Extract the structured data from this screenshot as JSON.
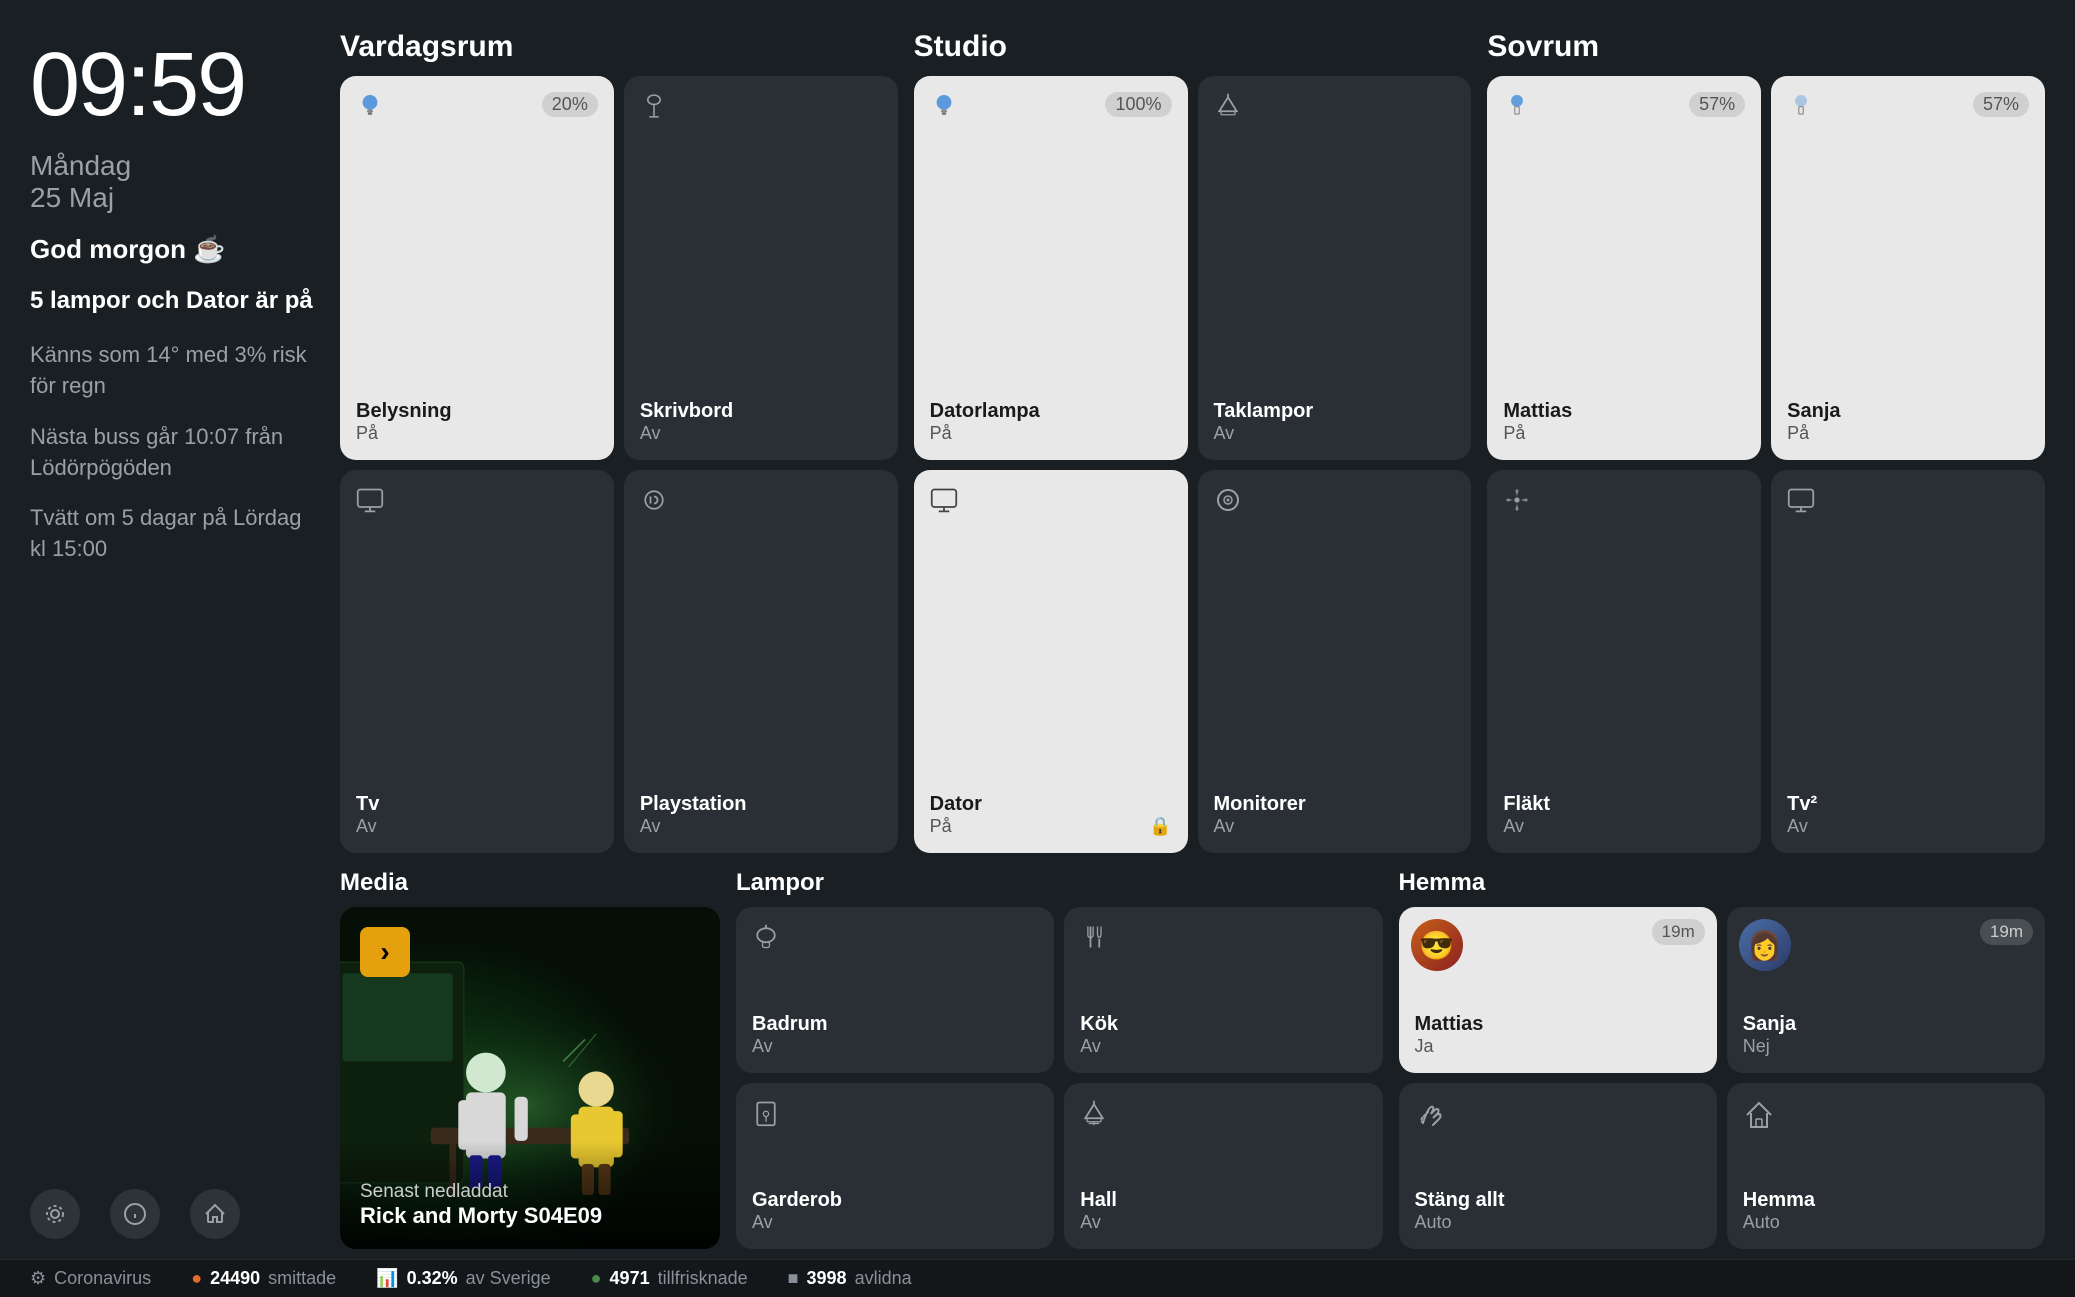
{
  "clock": {
    "time": "09:59",
    "day": "Måndag",
    "date": "25 Maj"
  },
  "sidebar": {
    "greeting": "God morgon ☕",
    "alert": "5 lampor och Dator är på",
    "weather": "Känns som 14° med 3% risk för regn",
    "bus": "Nästa buss går 10:07 från Lödörpögöden",
    "laundry": "Tvätt om 5 dagar på Lördag kl 15:00"
  },
  "rooms": {
    "vardagsrum": {
      "title": "Vardagsrum",
      "tiles": [
        {
          "label": "Belysning",
          "status": "På",
          "active": true,
          "percent": "20%",
          "icon": "bulb"
        },
        {
          "label": "Skrivbord",
          "status": "Av",
          "active": false,
          "icon": "lamp"
        },
        {
          "label": "Tv",
          "status": "Av",
          "active": false,
          "icon": "tv"
        },
        {
          "label": "Playstation",
          "status": "Av",
          "active": false,
          "icon": "ps"
        }
      ]
    },
    "studio": {
      "title": "Studio",
      "tiles": [
        {
          "label": "Datorlampa",
          "status": "På",
          "active": true,
          "percent": "100%",
          "icon": "bulb"
        },
        {
          "label": "Taklampor",
          "status": "Av",
          "active": false,
          "icon": "ceiling"
        },
        {
          "label": "Dator",
          "status": "På",
          "active": true,
          "icon": "monitor",
          "lock": true
        },
        {
          "label": "Monitorer",
          "status": "Av",
          "active": false,
          "icon": "speaker"
        }
      ]
    },
    "sovrum": {
      "title": "Sovrum",
      "tiles": [
        {
          "label": "Mattias",
          "status": "På",
          "active": true,
          "percent": "57%",
          "icon": "lamp2"
        },
        {
          "label": "Sanja",
          "status": "På",
          "active": true,
          "percent": "57%",
          "icon": "lamp2"
        },
        {
          "label": "Fläkt",
          "status": "Av",
          "active": false,
          "icon": "fan"
        },
        {
          "label": "Tv²",
          "status": "Av",
          "active": false,
          "icon": "tv"
        }
      ]
    }
  },
  "media": {
    "title": "Media",
    "caption_sub": "Senast nedladdat",
    "caption_title": "Rick and Morty S04E09"
  },
  "lampor": {
    "title": "Lampor",
    "tiles": [
      {
        "label": "Badrum",
        "status": "Av",
        "icon": "toilet"
      },
      {
        "label": "Kök",
        "status": "Av",
        "icon": "cutlery"
      },
      {
        "label": "Garderob",
        "status": "Av",
        "icon": "wardrobe"
      },
      {
        "label": "Hall",
        "status": "Av",
        "icon": "ceiling2"
      }
    ]
  },
  "hemma": {
    "title": "Hemma",
    "people": [
      {
        "name": "Mattias",
        "status": "Ja",
        "active": true,
        "time": "19m",
        "avatar": "M"
      },
      {
        "name": "Sanja",
        "status": "Nej",
        "active": false,
        "time": "19m",
        "avatar": "S"
      }
    ],
    "actions": [
      {
        "label": "Stäng allt",
        "status": "Auto",
        "icon": "wave"
      },
      {
        "label": "Hemma",
        "status": "Auto",
        "icon": "house"
      }
    ]
  },
  "statusbar": {
    "items": [
      {
        "icon": "⚙",
        "label": "Coronavirus"
      },
      {
        "icon": "●",
        "value": "24490",
        "label": "smittade"
      },
      {
        "icon": "📊",
        "value": "0.32%",
        "label": "av Sverige"
      },
      {
        "icon": "●",
        "value": "4971",
        "label": "tillfrisknade"
      },
      {
        "icon": "■",
        "value": "3998",
        "label": "avlidna"
      }
    ]
  }
}
